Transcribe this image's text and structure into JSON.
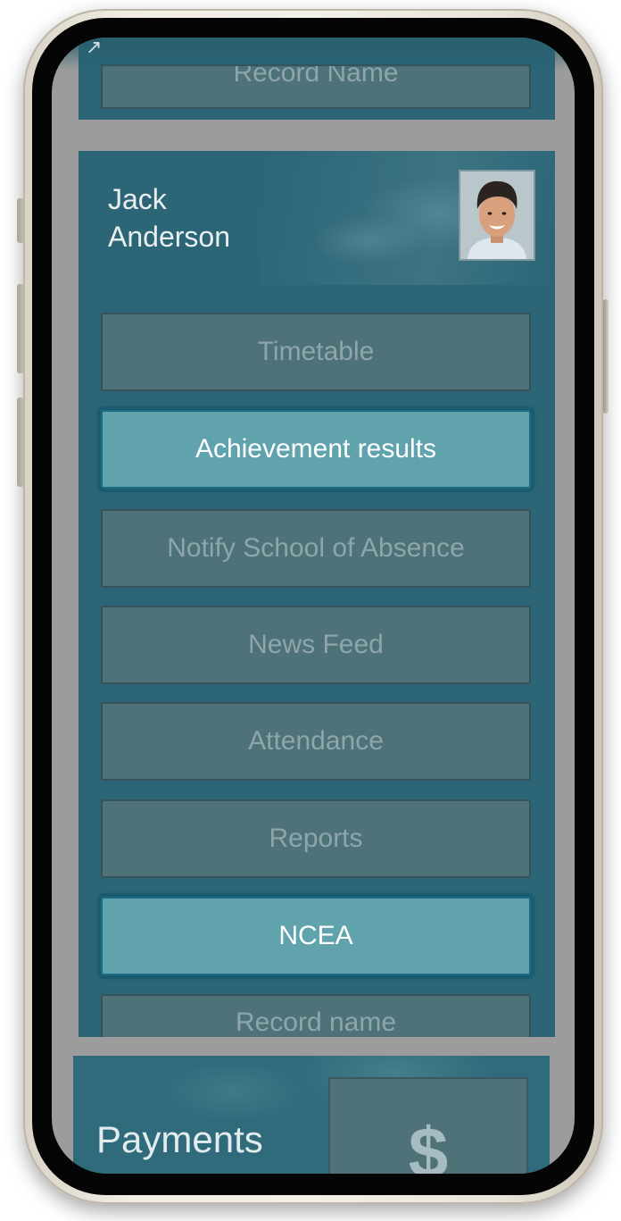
{
  "top_section": {
    "record_label": "Record Name"
  },
  "student": {
    "name": "Jack\nAnderson"
  },
  "menu": {
    "items": [
      {
        "label": "Timetable",
        "active": false
      },
      {
        "label": "Achievement results",
        "active": true
      },
      {
        "label": "Notify School of Absence",
        "active": false
      },
      {
        "label": "News Feed",
        "active": false
      },
      {
        "label": "Attendance",
        "active": false
      },
      {
        "label": "Reports",
        "active": false
      },
      {
        "label": "NCEA",
        "active": true
      },
      {
        "label": "Record name",
        "active": false
      }
    ]
  },
  "payments": {
    "label": "Payments",
    "icon_symbol": "$",
    "icon": "dollar-icon"
  },
  "colors": {
    "card": "#2b6576",
    "button": "#4f7178",
    "button_active": "#60a3ad",
    "text_muted": "#8ea6ab",
    "text_active": "#ffffff"
  }
}
